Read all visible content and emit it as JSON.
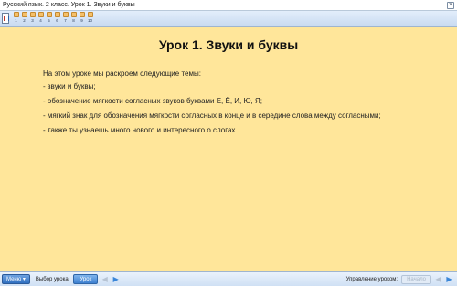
{
  "window": {
    "title": "Русский язык. 2 класс. Урок 1. Звуки и буквы",
    "close_glyph": "×"
  },
  "navigation": {
    "pages": [
      {
        "label": "1"
      },
      {
        "label": "2"
      },
      {
        "label": "3"
      },
      {
        "label": "4"
      },
      {
        "label": "5"
      },
      {
        "label": "6"
      },
      {
        "label": "7"
      },
      {
        "label": "8"
      },
      {
        "label": "9"
      },
      {
        "label": "10"
      }
    ]
  },
  "lesson": {
    "title": "Урок 1. Звуки и буквы",
    "intro": "На этом уроке мы раскроем следующие темы:",
    "topics": [
      "- звуки и буквы;",
      "- обозначение мягкости согласных звуков буквами Е, Ё, И, Ю, Я;",
      "- мягкий знак для обозначения мягкости согласных в конце и в середине слова между согласными;",
      "- также ты узнаешь много нового и интересного о слогах."
    ]
  },
  "bottom_bar": {
    "menu_label": "Меню ▾",
    "lesson_select_label": "Выбор урока:",
    "lesson_button": "Урок",
    "lesson_management_label": "Управление уроком:",
    "start_button": "Начало"
  },
  "colors": {
    "background": "#ffe69a",
    "accent": "#3a86d8"
  }
}
